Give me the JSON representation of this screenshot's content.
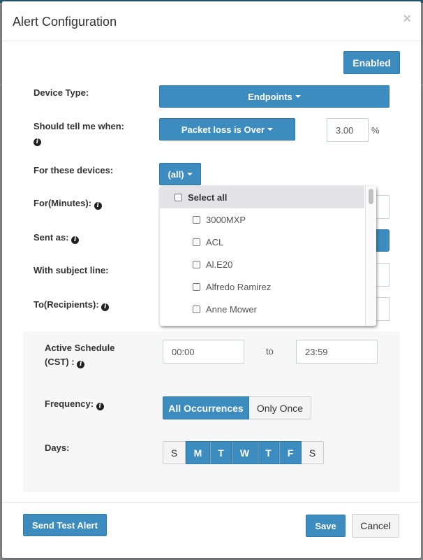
{
  "modal": {
    "title": "Alert Configuration",
    "close_glyph": "×",
    "enabled_label": "Enabled"
  },
  "form": {
    "device_type": {
      "label": "Device Type:",
      "value": "Endpoints"
    },
    "condition": {
      "label": "Should tell me when:",
      "value": "Packet loss is Over",
      "threshold": "3.00",
      "unit": "%"
    },
    "devices": {
      "label": "For these devices:",
      "value": "(all)"
    },
    "minutes": {
      "label": "For(Minutes):"
    },
    "sent_as": {
      "label": "Sent as:"
    },
    "subject": {
      "label": "With subject line:"
    },
    "recipients": {
      "label": "To(Recipients):"
    }
  },
  "device_dropdown": {
    "select_all_label": "Select all",
    "options": [
      "3000MXP",
      "ACL",
      "Al.E20",
      "Alfredo Ramirez",
      "Anne Mower"
    ]
  },
  "schedule": {
    "label_line1": "Active Schedule",
    "label_line2": "(CST) :",
    "start": "00:00",
    "to_label": "to",
    "end": "23:59",
    "frequency_label": "Frequency:",
    "frequency_options": [
      {
        "label": "All Occurrences",
        "active": true
      },
      {
        "label": "Only Once",
        "active": false
      }
    ],
    "days_label": "Days:",
    "days": [
      {
        "label": "S",
        "active": false
      },
      {
        "label": "M",
        "active": true
      },
      {
        "label": "T",
        "active": true
      },
      {
        "label": "W",
        "active": true
      },
      {
        "label": "T",
        "active": true
      },
      {
        "label": "F",
        "active": true
      },
      {
        "label": "S",
        "active": false
      }
    ]
  },
  "footer": {
    "test_label": "Send Test Alert",
    "save_label": "Save",
    "cancel_label": "Cancel"
  },
  "icons": {
    "info": "i"
  },
  "colors": {
    "primary": "#3d8cbf",
    "panel": "#f7f7f7"
  }
}
